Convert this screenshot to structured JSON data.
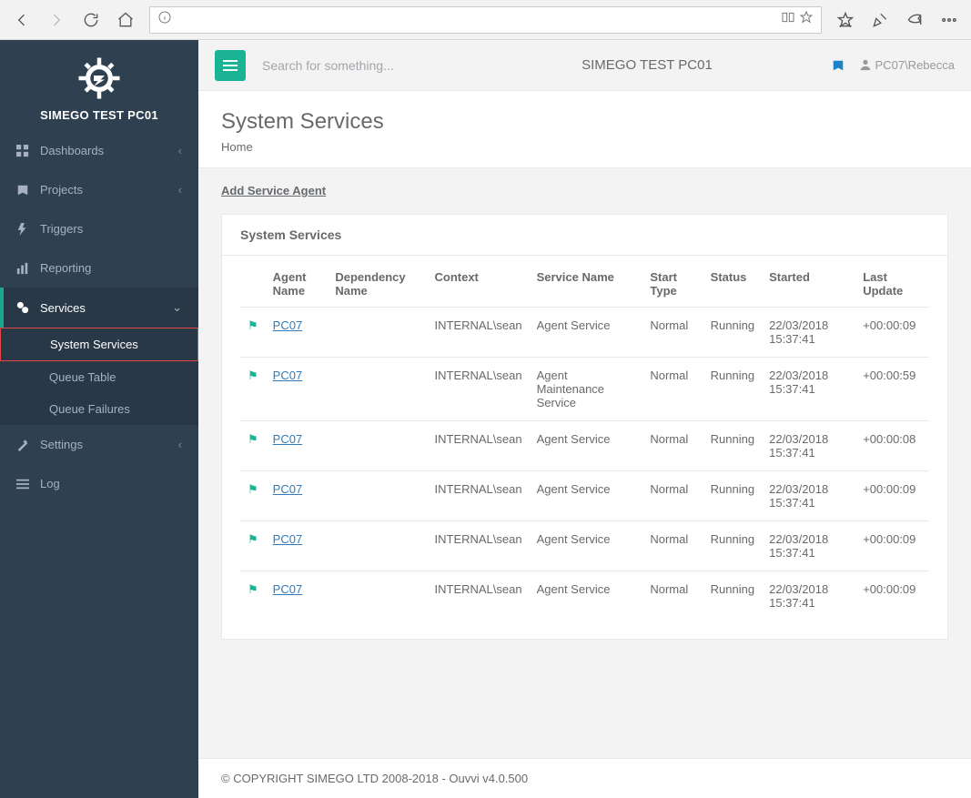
{
  "search_placeholder": "Search for something...",
  "app_title": "SIMEGO TEST PC01",
  "user": "PC07\\Rebecca",
  "brand": "SIMEGO TEST PC01",
  "nav": {
    "dashboards": "Dashboards",
    "projects": "Projects",
    "triggers": "Triggers",
    "reporting": "Reporting",
    "services": "Services",
    "settings": "Settings",
    "log": "Log"
  },
  "sub": {
    "system_services": "System Services",
    "queue_table": "Queue Table",
    "queue_failures": "Queue Failures"
  },
  "page": {
    "title": "System Services",
    "breadcrumb": "Home",
    "action": "Add Service Agent",
    "panel_title": "System Services"
  },
  "cols": [
    "",
    "Agent Name",
    "Dependency Name",
    "Context",
    "Service Name",
    "Start Type",
    "Status",
    "Started",
    "Last Update"
  ],
  "rows": [
    {
      "agent": "PC07",
      "dep": "",
      "ctx": "INTERNAL\\sean",
      "svc": "Agent Service",
      "start": "Normal",
      "status": "Running",
      "started": "22/03/2018 15:37:41",
      "upd": "+00:00:09"
    },
    {
      "agent": "PC07",
      "dep": "",
      "ctx": "INTERNAL\\sean",
      "svc": "Agent Maintenance Service",
      "start": "Normal",
      "status": "Running",
      "started": "22/03/2018 15:37:41",
      "upd": "+00:00:59"
    },
    {
      "agent": "PC07",
      "dep": "",
      "ctx": "INTERNAL\\sean",
      "svc": "Agent Service",
      "start": "Normal",
      "status": "Running",
      "started": "22/03/2018 15:37:41",
      "upd": "+00:00:08"
    },
    {
      "agent": "PC07",
      "dep": "",
      "ctx": "INTERNAL\\sean",
      "svc": "Agent Service",
      "start": "Normal",
      "status": "Running",
      "started": "22/03/2018 15:37:41",
      "upd": "+00:00:09"
    },
    {
      "agent": "PC07",
      "dep": "",
      "ctx": "INTERNAL\\sean",
      "svc": "Agent Service",
      "start": "Normal",
      "status": "Running",
      "started": "22/03/2018 15:37:41",
      "upd": "+00:00:09"
    },
    {
      "agent": "PC07",
      "dep": "",
      "ctx": "INTERNAL\\sean",
      "svc": "Agent Service",
      "start": "Normal",
      "status": "Running",
      "started": "22/03/2018 15:37:41",
      "upd": "+00:00:09"
    }
  ],
  "footer": "© COPYRIGHT SIMEGO LTD 2008-2018 - Ouvvi v4.0.500"
}
